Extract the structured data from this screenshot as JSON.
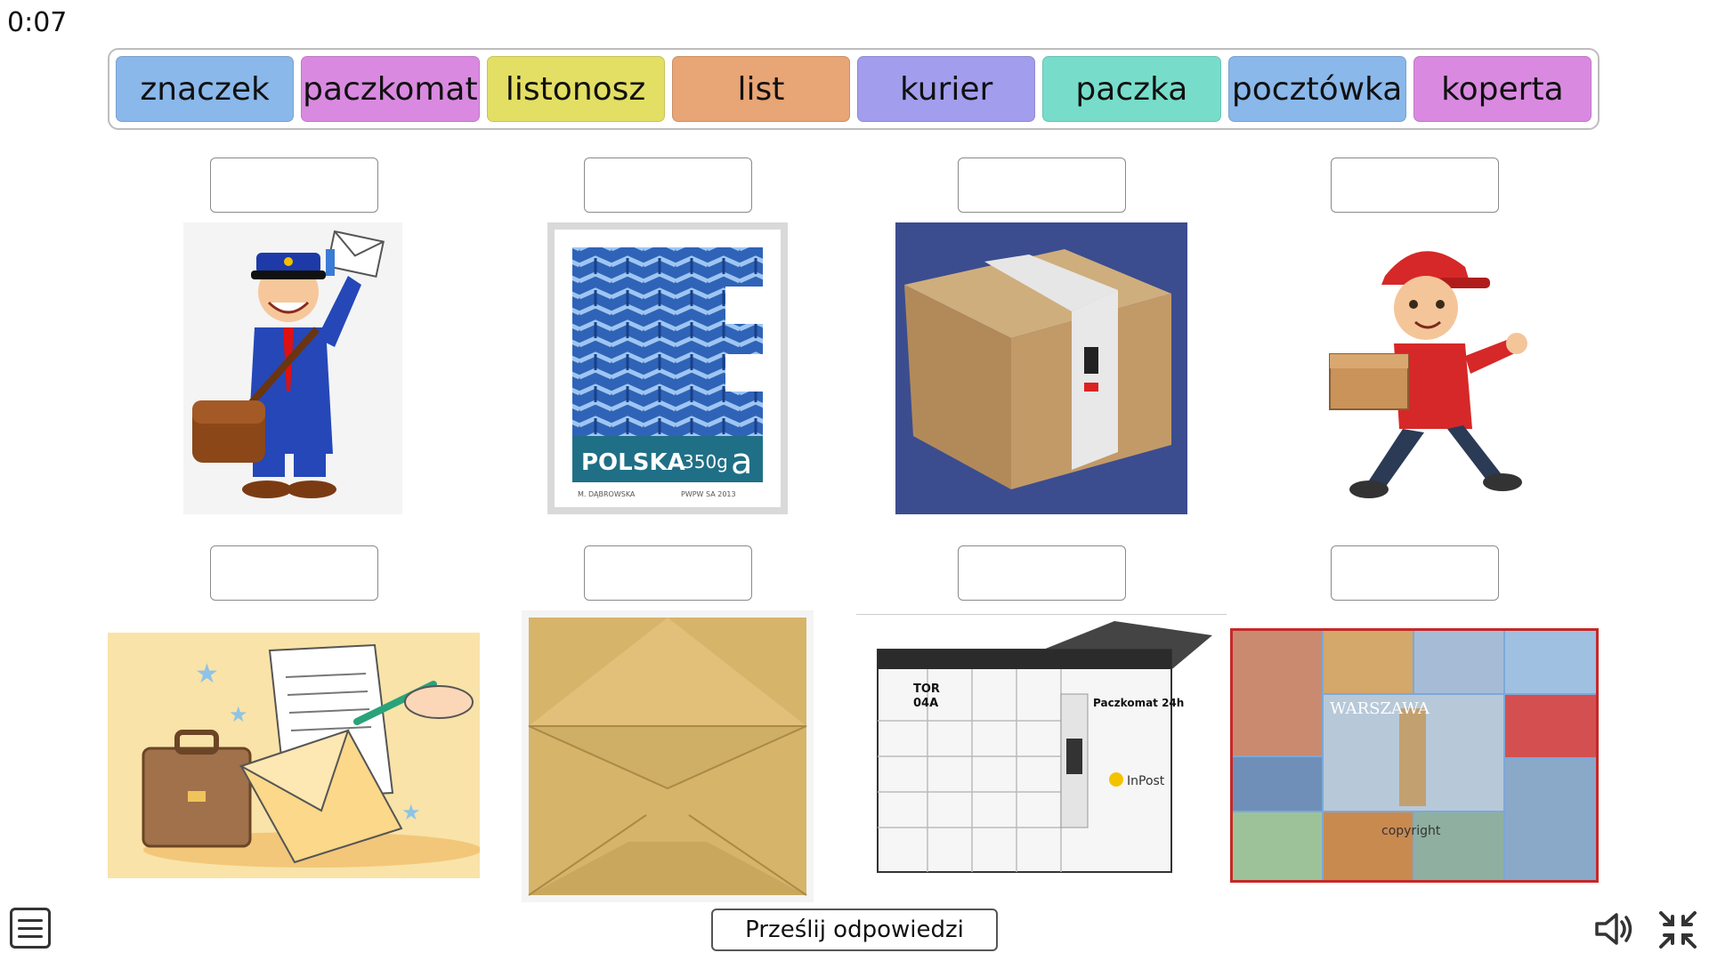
{
  "timer": "0:07",
  "words": [
    {
      "label": "znaczek",
      "color": "#8ab8ea"
    },
    {
      "label": "paczkomat",
      "color": "#d98ae0"
    },
    {
      "label": "listonosz",
      "color": "#e3df64"
    },
    {
      "label": "list",
      "color": "#e8a575"
    },
    {
      "label": "kurier",
      "color": "#a39dee"
    },
    {
      "label": "paczka",
      "color": "#77ddca"
    },
    {
      "label": "pocztówka",
      "color": "#8ab8ea"
    },
    {
      "label": "koperta",
      "color": "#d98ae0"
    }
  ],
  "images": {
    "stamp": {
      "country": "POLSKA",
      "value": "350g",
      "letter": "a",
      "author": "M. DĄBROWSKA",
      "printer": "PWPW SA 2013"
    },
    "locker": {
      "code_line1": "TOR",
      "code_line2": "04A",
      "brand": "Paczkomat 24h",
      "logo": "InPost"
    },
    "postcard": {
      "city": "WARSZAWA",
      "watermark": "copyright"
    }
  },
  "submit_label": "Prześlij odpowiedzi",
  "icons": {
    "menu": "menu-icon",
    "sound": "speaker-icon",
    "exit_fullscreen": "exit-fullscreen-icon"
  }
}
